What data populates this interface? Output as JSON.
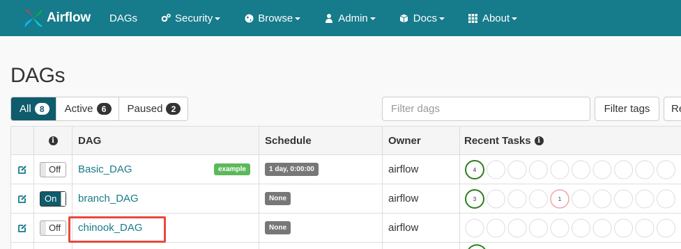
{
  "navbar": {
    "brand": "Airflow",
    "items": [
      {
        "label": "DAGs",
        "icon": "",
        "caret": false
      },
      {
        "label": "Security",
        "icon": "gears-icon",
        "caret": true
      },
      {
        "label": "Browse",
        "icon": "globe-icon",
        "caret": true
      },
      {
        "label": "Admin",
        "icon": "user-icon",
        "caret": true
      },
      {
        "label": "Docs",
        "icon": "cube-icon",
        "caret": true
      },
      {
        "label": "About",
        "icon": "grid-icon",
        "caret": true
      }
    ]
  },
  "page_title": "DAGs",
  "status_tabs": [
    {
      "label": "All",
      "count": "8",
      "active": true
    },
    {
      "label": "Active",
      "count": "6",
      "active": false
    },
    {
      "label": "Paused",
      "count": "2",
      "active": false
    }
  ],
  "filter": {
    "placeholder": "Filter dags",
    "tags_button": "Filter tags",
    "reset_button": "Re"
  },
  "table": {
    "headers": {
      "info": "i",
      "dag": "DAG",
      "schedule": "Schedule",
      "owner": "Owner",
      "recent_tasks": "Recent Tasks"
    },
    "rows": [
      {
        "toggle": "Off",
        "dag": "Basic_DAG",
        "tag": "example",
        "schedule": "1 day, 0:00:00",
        "owner": "airflow",
        "task_circles": [
          {
            "count": "4",
            "color": "#2e7d1f"
          },
          {
            "count": "",
            "color": ""
          },
          {
            "count": "",
            "color": ""
          },
          {
            "count": "",
            "color": ""
          },
          {
            "count": "",
            "color": ""
          },
          {
            "count": "",
            "color": ""
          },
          {
            "count": "",
            "color": ""
          },
          {
            "count": "",
            "color": ""
          },
          {
            "count": "",
            "color": ""
          },
          {
            "count": "",
            "color": ""
          }
        ]
      },
      {
        "toggle": "On",
        "dag": "branch_DAG",
        "tag": "",
        "schedule": "None",
        "owner": "airflow",
        "task_circles": [
          {
            "count": "3",
            "color": "#2e7d1f"
          },
          {
            "count": "",
            "color": ""
          },
          {
            "count": "",
            "color": ""
          },
          {
            "count": "",
            "color": ""
          },
          {
            "count": "1",
            "color": "#f2a3a9"
          },
          {
            "count": "",
            "color": ""
          },
          {
            "count": "",
            "color": ""
          },
          {
            "count": "",
            "color": ""
          },
          {
            "count": "",
            "color": ""
          },
          {
            "count": "",
            "color": ""
          }
        ]
      },
      {
        "toggle": "Off",
        "dag": "chinook_DAG",
        "tag": "",
        "schedule": "None",
        "owner": "airflow",
        "task_circles": [
          {
            "count": "",
            "color": ""
          },
          {
            "count": "",
            "color": ""
          },
          {
            "count": "",
            "color": ""
          },
          {
            "count": "",
            "color": ""
          },
          {
            "count": "",
            "color": ""
          },
          {
            "count": "",
            "color": ""
          },
          {
            "count": "",
            "color": ""
          },
          {
            "count": "",
            "color": ""
          },
          {
            "count": "",
            "color": ""
          },
          {
            "count": "",
            "color": ""
          }
        ]
      }
    ]
  },
  "colors": {
    "navbar_bg": "#167b8a",
    "active_tab": "#0f5c6c",
    "link": "#167b8a",
    "tag_green": "#5cb85c",
    "success_circle": "#2e7d1f",
    "failed_circle": "#f2a3a9",
    "highlight": "#e8493d"
  }
}
